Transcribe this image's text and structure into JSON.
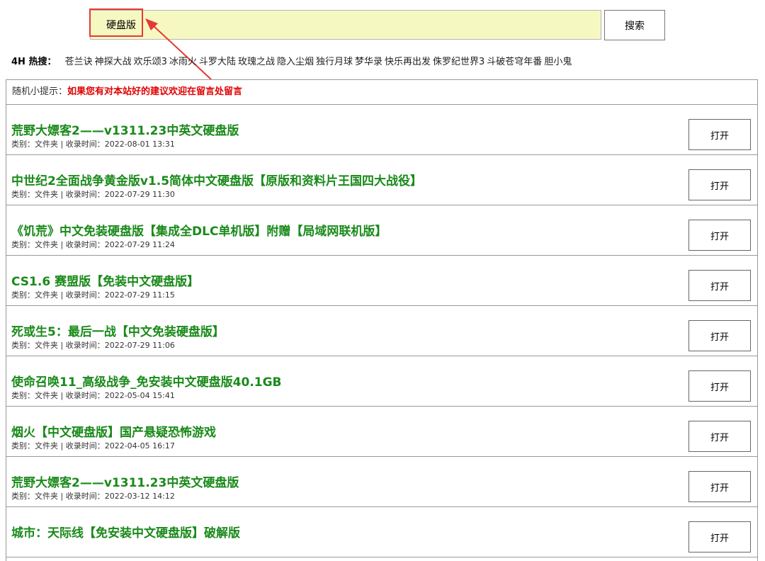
{
  "search": {
    "value": "硬盘版",
    "button_label": "搜索"
  },
  "hot": {
    "label": "4H 热搜：",
    "items": [
      "苍兰诀",
      "神探大战",
      "欢乐颂3",
      "冰雨火",
      "斗罗大陆",
      "玫瑰之战",
      "隐入尘烟",
      "独行月球",
      "梦华录",
      "快乐再出发",
      "侏罗纪世界3",
      "斗破苍穹年番",
      "胆小鬼"
    ]
  },
  "tip": {
    "label": "随机小提示：",
    "text": "如果您有对本站好的建议欢迎在留言处留言"
  },
  "results": [
    {
      "title": "荒野大嫖客2——v1311.23中英文硬盘版",
      "meta": "类别：文件夹 | 收录时间：2022-08-01 13:31",
      "button": "打开"
    },
    {
      "title": "中世纪2全面战争黄金版v1.5简体中文硬盘版【原版和资料片王国四大战役】",
      "meta": "类别：文件夹 | 收录时间：2022-07-29 11:30",
      "button": "打开"
    },
    {
      "title": "《饥荒》中文免装硬盘版【集成全DLC单机版】附赠【局域网联机版】",
      "meta": "类别：文件夹 | 收录时间：2022-07-29 11:24",
      "button": "打开"
    },
    {
      "title": "CS1.6 赛盟版【免装中文硬盘版】",
      "meta": "类别：文件夹 | 收录时间：2022-07-29 11:15",
      "button": "打开"
    },
    {
      "title": "死或生5：最后一战【中文免装硬盘版】",
      "meta": "类别：文件夹 | 收录时间：2022-07-29 11:06",
      "button": "打开"
    },
    {
      "title": "使命召唤11_高级战争_免安装中文硬盘版40.1GB",
      "meta": "类别：文件夹 | 收录时间：2022-05-04 15:41",
      "button": "打开"
    },
    {
      "title": "烟火【中文硬盘版】国产悬疑恐怖游戏",
      "meta": "类别：文件夹 | 收录时间：2022-04-05 16:17",
      "button": "打开"
    },
    {
      "title": "荒野大嫖客2——v1311.23中英文硬盘版",
      "meta": "类别：文件夹 | 收录时间：2022-03-12 14:12",
      "button": "打开"
    },
    {
      "title": "城市：天际线【免安装中文硬盘版】破解版",
      "meta": "",
      "button": "打开"
    }
  ],
  "colors": {
    "title_green": "#1a8a1a",
    "tip_red": "#e00000",
    "annotation_red": "#e53935",
    "search_bg": "#f6f8c2"
  }
}
